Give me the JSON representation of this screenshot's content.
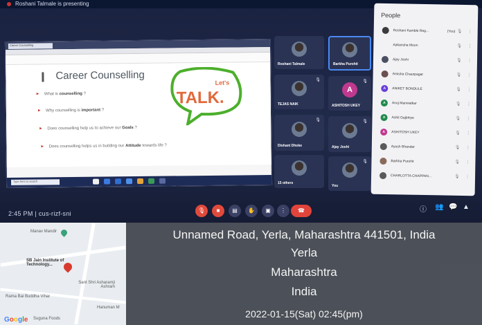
{
  "banner": {
    "text": "Roshani Talmale is presenting"
  },
  "browser": {
    "tab_label": "Career Counselling",
    "taskbar_search": "Type here to search"
  },
  "slide": {
    "title": "Career Counselling",
    "bubble_top": "Let's",
    "bubble_main": "TALK.",
    "bullets": [
      {
        "pre": "What is ",
        "bold": "counselling",
        "post": " ?"
      },
      {
        "pre": "Why counselling is ",
        "bold": "important",
        "post": " ?"
      },
      {
        "pre": "Does counselling help us to achieve our ",
        "bold": "Goals",
        "post": " ?"
      },
      {
        "pre": "Does counselling helps us in building our ",
        "bold": "Attitude",
        "post": " towards life ?"
      }
    ]
  },
  "tiles": [
    {
      "name": "Roshani Talmale"
    },
    {
      "name": "Barkha Purohit"
    },
    {
      "name": "TEJAS NAIK"
    },
    {
      "name": "ASHITOSH UKEY",
      "initial": "A"
    },
    {
      "name": "Dishant Dhoke"
    },
    {
      "name": "Ajay Joshi"
    },
    {
      "name": "15 others"
    },
    {
      "name": "You"
    }
  ],
  "people": {
    "title": "People",
    "rows": [
      {
        "name": "Roshani Kamble Reg...",
        "extra": "(You)",
        "color": "#3b3b3b"
      },
      {
        "name": "Aakansha Moon",
        "color": "#f2f2f5"
      },
      {
        "name": "Ajay Joshi",
        "color": "#4a4f62"
      },
      {
        "name": "Amisha Chaurpagar",
        "color": "#6a5050"
      },
      {
        "name": "ANIKET BONDULE",
        "initial": "A",
        "color": "#6a3fd6"
      },
      {
        "name": "Anuj Manwatkar",
        "initial": "A",
        "color": "#1f8a4c"
      },
      {
        "name": "Ashit Gajbhiye",
        "initial": "A",
        "color": "#1f8a4c"
      },
      {
        "name": "ASHITOSH UKEY",
        "initial": "A",
        "color": "#c0398f"
      },
      {
        "name": "Ayush Bhandar",
        "color": "#5a5a5a"
      },
      {
        "name": "Barkha Purohit",
        "color": "#8a6b5a"
      },
      {
        "name": "CHARLOTTA CHAPPAN...",
        "color": "#5a5a5a"
      }
    ]
  },
  "clock": "2:45 PM | cus-rizf-sni",
  "map": {
    "labels": {
      "mandir": "Manav Mandir",
      "institute": "SB Jain Institute of Technology...",
      "ashram": "Sant Shri Asharamji Ashram",
      "vihar": "Rama Bai Buddha Vihar",
      "hanuman": "Hanuman M",
      "foods": "Suguna Foods"
    },
    "logo": "Google"
  },
  "stamp": {
    "address": "Unnamed Road, Yerla, Maharashtra 441501, India",
    "city": "Yerla",
    "state": "Maharashtra",
    "country": "India",
    "datetime": "2022-01-15(Sat)  02:45(pm)"
  },
  "colors": {
    "accent_red": "#e04a3c",
    "bubble_green": "#4caf2c",
    "talk_orange": "#e2683a"
  }
}
